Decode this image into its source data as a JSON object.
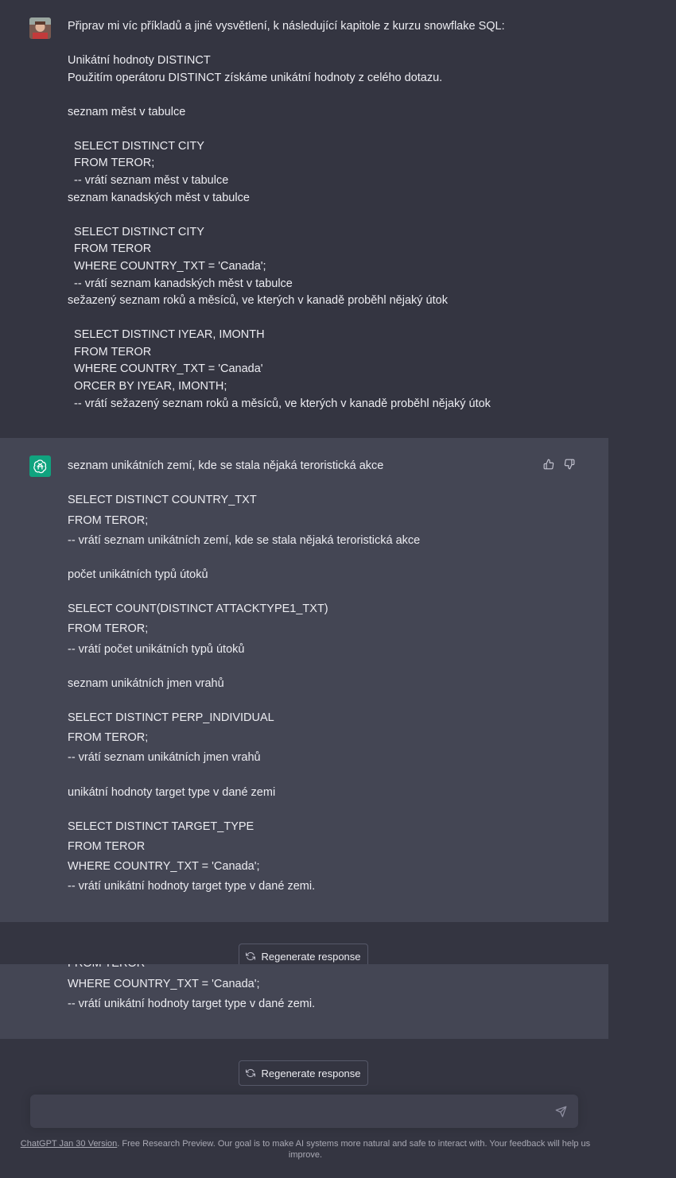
{
  "user_message": {
    "lines": [
      "Připrav mi víc příkladů a jiné vysvětlení, k následující kapitole z kurzu snowflake SQL:",
      "Unikátní hodnoty DISTINCT",
      "Použitím operátoru DISTINCT získáme unikátní hodnoty z celého dotazu.",
      "seznam měst v tabulce",
      "  SELECT DISTINCT CITY",
      "  FROM TEROR;",
      "  -- vrátí seznam měst v tabulce",
      "seznam kanadských měst v tabulce",
      "  SELECT DISTINCT CITY",
      "  FROM TEROR",
      "  WHERE COUNTRY_TXT = 'Canada';",
      "  -- vrátí seznam kanadských měst v tabulce",
      "sežazený seznam roků a měsíců, ve kterých v kanadě proběhl nějaký útok",
      "  SELECT DISTINCT IYEAR, IMONTH",
      "  FROM TEROR",
      "  WHERE COUNTRY_TXT = 'Canada'",
      "  ORCER BY IYEAR, IMONTH;",
      "  -- vrátí sežazený seznam roků a měsíců, ve kterých v kanadě proběhl nějaký útok"
    ]
  },
  "assistant_message": {
    "lines": [
      "seznam unikátních zemí, kde se stala nějaká teroristická akce",
      "SELECT DISTINCT COUNTRY_TXT",
      "FROM TEROR;",
      "-- vrátí seznam unikátních zemí, kde se stala nějaká teroristická akce",
      "počet unikátních typů útoků",
      "SELECT COUNT(DISTINCT ATTACKTYPE1_TXT)",
      "FROM TEROR;",
      "-- vrátí počet unikátních typů útoků",
      "seznam unikátních jmen vrahů",
      "SELECT DISTINCT PERP_INDIVIDUAL",
      "FROM TEROR;",
      "-- vrátí seznam unikátních jmen vrahů",
      "unikátní hodnoty target type v dané zemi",
      "SELECT DISTINCT TARGET_TYPE",
      "FROM TEROR",
      "WHERE COUNTRY_TXT = 'Canada';",
      "-- vrátí unikátní hodnoty target type v dané zemi."
    ]
  },
  "duplicate_tail": {
    "lines": [
      "FROM TEROR",
      "WHERE COUNTRY_TXT = 'Canada';",
      "-- vrátí unikátní hodnoty target type v dané zemi."
    ]
  },
  "regenerate_label": "Regenerate response",
  "footer": {
    "version_link": "ChatGPT Jan 30 Version",
    "text": ". Free Research Preview. Our goal is to make AI systems more natural and safe to interact with. Your feedback will help us improve."
  },
  "icons": {
    "thumbs_up": "thumbs-up-icon",
    "thumbs_down": "thumbs-down-icon",
    "regenerate": "refresh-icon",
    "send": "send-icon",
    "assistant_avatar": "openai-logo-icon"
  },
  "colors": {
    "background": "#343541",
    "assistant_bg": "#444654",
    "brand_green": "#10a37f",
    "input_bg": "#40414f"
  }
}
